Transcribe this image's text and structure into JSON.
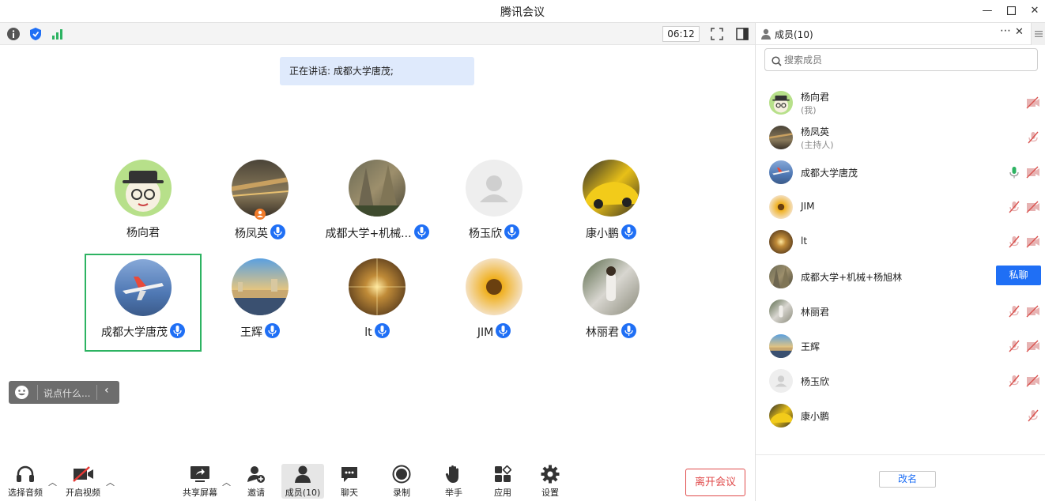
{
  "window": {
    "title": "腾讯会议"
  },
  "topbar": {
    "timer": "06:12"
  },
  "speaking": {
    "text": "正在讲话: 成都大学唐茂;"
  },
  "tiles": [
    {
      "name": "杨向君",
      "mic": false
    },
    {
      "name": "杨凤英",
      "mic": true
    },
    {
      "name": "成都大学+机械...",
      "mic": true
    },
    {
      "name": "杨玉欣",
      "mic": true
    },
    {
      "name": "康小鹏",
      "mic": true
    },
    {
      "name": "成都大学唐茂",
      "mic": true
    },
    {
      "name": "王辉",
      "mic": true
    },
    {
      "name": "lt",
      "mic": true
    },
    {
      "name": "JIM",
      "mic": true
    },
    {
      "name": "林丽君",
      "mic": true
    }
  ],
  "chat": {
    "placeholder": "说点什么..."
  },
  "bottom": {
    "audio": "选择音频",
    "video": "开启视频",
    "share": "共享屏幕",
    "invite": "邀请",
    "members": "成员(10)",
    "chat": "聊天",
    "record": "录制",
    "raise": "举手",
    "apps": "应用",
    "settings": "设置",
    "leave": "离开会议"
  },
  "panel": {
    "title": "成员(10)",
    "search_placeholder": "搜索成员",
    "rename": "改名",
    "private_chat": "私聊",
    "members": [
      {
        "name": "杨向君",
        "role": "(我)"
      },
      {
        "name": "杨凤英",
        "role": "(主持人)"
      },
      {
        "name": "成都大学唐茂",
        "role": ""
      },
      {
        "name": "JIM",
        "role": ""
      },
      {
        "name": "lt",
        "role": ""
      },
      {
        "name": "成都大学+机械+杨旭林",
        "role": ""
      },
      {
        "name": "林丽君",
        "role": ""
      },
      {
        "name": "王辉",
        "role": ""
      },
      {
        "name": "杨玉欣",
        "role": ""
      },
      {
        "name": "康小鹏",
        "role": ""
      }
    ]
  },
  "colors": {
    "accent": "#1f6ff5",
    "leave": "#e04b4b",
    "active_border": "#2db362",
    "speaking_bg": "#dfeafc"
  }
}
